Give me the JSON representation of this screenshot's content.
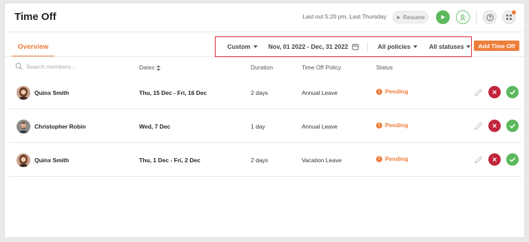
{
  "header": {
    "title": "Time Off",
    "last_out": "Last out 5:20 pm, Last Thursday",
    "resume_label": "Resume"
  },
  "tabs": [
    {
      "label": "Overview",
      "active": true
    }
  ],
  "filters": {
    "range_type": "Custom",
    "date_range": "Nov, 01 2022 - Dec, 31 2022",
    "policies": "All policies",
    "statuses": "All statuses"
  },
  "add_button": "Add Time Off",
  "search": {
    "placeholder": "Search members...",
    "value": ""
  },
  "columns": {
    "dates": "Dates",
    "duration": "Duration",
    "policy": "Time Off Policy",
    "status": "Status"
  },
  "rows": [
    {
      "name": "Quinx Smith",
      "dates": "Thu, 15 Dec - Fri, 16 Dec",
      "duration": "2 days",
      "policy": "Annual Leave",
      "status": "Pending"
    },
    {
      "name": "Christopher Robin",
      "dates": "Wed, 7 Dec",
      "duration": "1 day",
      "policy": "Annual Leave",
      "status": "Pending"
    },
    {
      "name": "Quinx Smith",
      "dates": "Thu, 1 Dec - Fri, 2 Dec",
      "duration": "2 days",
      "policy": "Vacation Leave",
      "status": "Pending"
    }
  ],
  "colors": {
    "accent": "#ee7d3b",
    "approve": "#5cb85c",
    "reject": "#c0263b",
    "highlight": "#d9232d"
  },
  "icons": [
    "play-icon",
    "user-icon",
    "help-icon",
    "apps-icon",
    "calendar-icon",
    "search-icon",
    "sort-icon",
    "pencil-icon",
    "close-icon",
    "check-icon",
    "alert-icon"
  ]
}
